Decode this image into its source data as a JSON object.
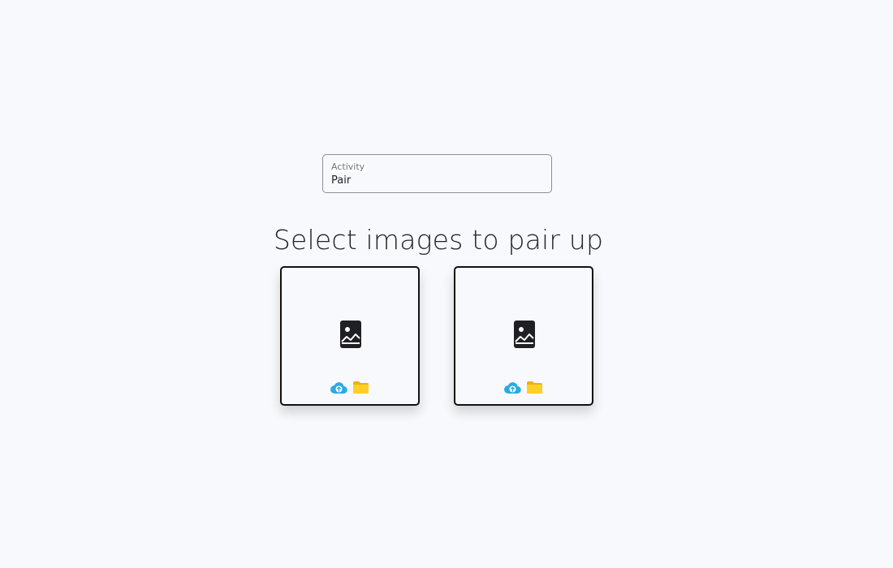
{
  "activity": {
    "label": "Activity",
    "value": "Pair"
  },
  "heading": "Select images to pair up",
  "cards": [
    {
      "icon": "image-placeholder-icon",
      "actions": [
        "upload-cloud-icon",
        "folder-icon"
      ]
    },
    {
      "icon": "image-placeholder-icon",
      "actions": [
        "upload-cloud-icon",
        "folder-icon"
      ]
    }
  ],
  "colors": {
    "background": "#f8f9fc",
    "upload_icon": "#29aae3",
    "folder_icon": "#f5c518",
    "card_border": "#111111"
  }
}
